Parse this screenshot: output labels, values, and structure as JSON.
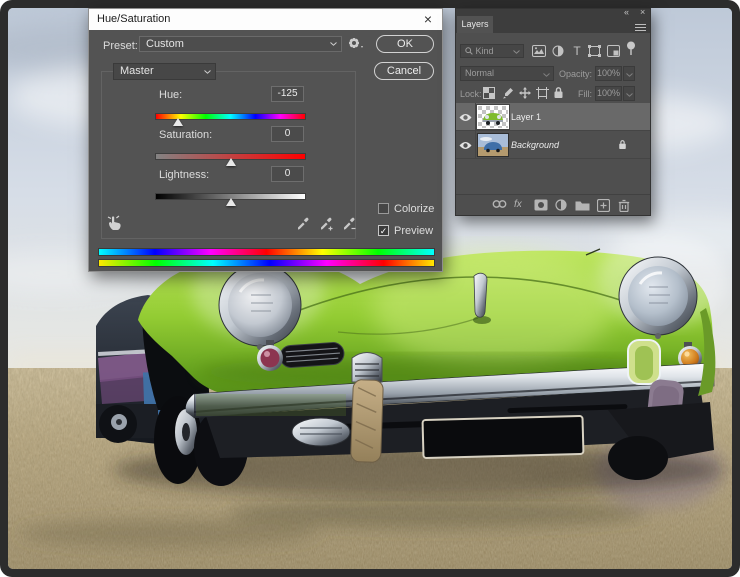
{
  "dialog": {
    "title": "Hue/Saturation",
    "close": "×",
    "preset_label": "Preset:",
    "preset_value": "Custom",
    "ok_label": "OK",
    "cancel_label": "Cancel",
    "channel_value": "Master",
    "hue_label": "Hue:",
    "hue_value": "-125",
    "saturation_label": "Saturation:",
    "saturation_value": "0",
    "lightness_label": "Lightness:",
    "lightness_value": "0",
    "colorize_label": "Colorize",
    "colorize_checked": false,
    "preview_label": "Preview",
    "preview_checked": true
  },
  "layers_panel": {
    "collapse_icon": "«",
    "close_icon": "×",
    "tab_label": "Layers",
    "kind_label": "Kind",
    "blend_mode": "Normal",
    "opacity_label": "Opacity:",
    "opacity_value": "100%",
    "lock_label": "Lock:",
    "fill_label": "Fill:",
    "fill_value": "100%",
    "fx_label": "fx",
    "layers": [
      {
        "name": "Layer 1",
        "selected": true,
        "visible": true,
        "locked": false
      },
      {
        "name": "Background",
        "selected": false,
        "visible": true,
        "locked": true
      }
    ]
  },
  "icons": {
    "check": "✓",
    "text_tool": "T"
  },
  "colors": {
    "panel_bg": "#4f4f4f",
    "dialog_bg": "#535353",
    "selected_row": "#696969",
    "car_green": "#8fc92f",
    "sky": "#ccd5e0",
    "field": "#ad9a70"
  }
}
